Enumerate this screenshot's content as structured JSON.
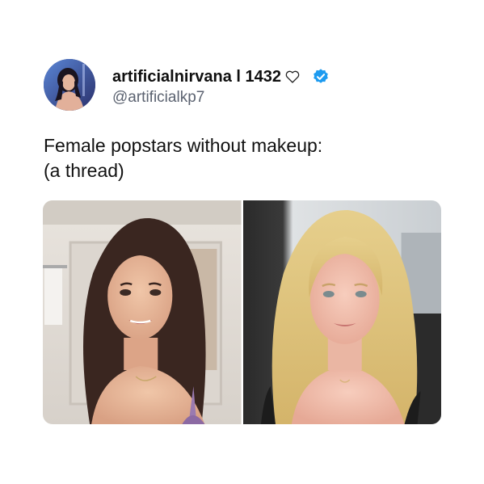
{
  "tweet": {
    "author": {
      "display_name": "artificialnirvana l 1432",
      "handle": "@artificialkp7",
      "verified": true,
      "name_emoji": "heart-outline-icon",
      "avatar": "profile-photo"
    },
    "text_lines": [
      "Female popstars without makeup:",
      "(a thread)"
    ],
    "media": [
      {
        "description": "photo-left"
      },
      {
        "description": "photo-right"
      }
    ]
  },
  "colors": {
    "verified_badge": "#1d9bf0",
    "handle": "#5b6270",
    "text": "#111111"
  }
}
